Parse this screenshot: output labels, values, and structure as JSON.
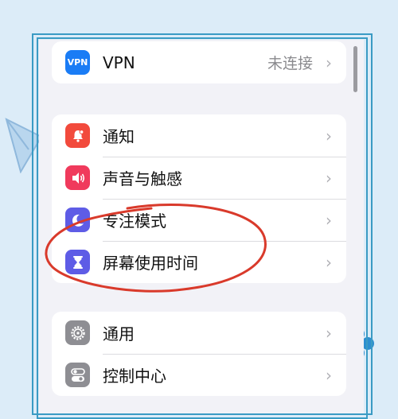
{
  "colors": {
    "background": "#dcecf8",
    "frame": "#3a9bc4",
    "screen": "#f2f2f7",
    "annotation": "#d93a2b"
  },
  "groups": [
    {
      "rows": [
        {
          "name": "vpn",
          "label": "VPN",
          "value": "未连接",
          "icon": "vpn-icon",
          "icon_text": "VPN",
          "icon_color": "#1a7cf5"
        }
      ]
    },
    {
      "rows": [
        {
          "name": "notifications",
          "label": "通知",
          "icon": "bell-icon",
          "icon_color": "#f24a3c"
        },
        {
          "name": "sounds",
          "label": "声音与触感",
          "icon": "speaker-icon",
          "icon_color": "#f03a5c"
        },
        {
          "name": "focus",
          "label": "专注模式",
          "icon": "moon-icon",
          "icon_color": "#5e5ce6"
        },
        {
          "name": "screen-time",
          "label": "屏幕使用时间",
          "icon": "hourglass-icon",
          "icon_color": "#5e5ce6"
        }
      ]
    },
    {
      "rows": [
        {
          "name": "general",
          "label": "通用",
          "icon": "gear-icon",
          "icon_color": "#8e8e93"
        },
        {
          "name": "control-center",
          "label": "控制中心",
          "icon": "toggles-icon",
          "icon_color": "#8e8e93"
        }
      ]
    }
  ],
  "chevron": "›"
}
